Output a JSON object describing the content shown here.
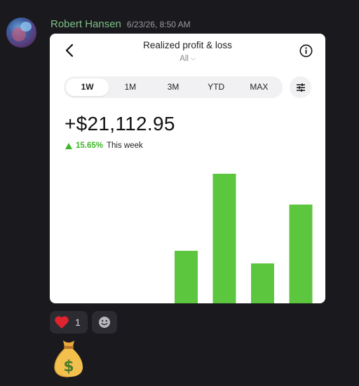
{
  "message": {
    "author": "Robert Hansen",
    "timestamp": "6/23/26, 8:50 AM"
  },
  "card": {
    "title": "Realized profit & loss",
    "filter": "All",
    "tabs": [
      "1W",
      "1M",
      "3M",
      "YTD",
      "MAX"
    ],
    "active_tab": "1W",
    "amount": "+$21,112.95",
    "change_pct": "15.65%",
    "change_period": "This week",
    "accent_color": "#5cc63f"
  },
  "chart_data": {
    "type": "bar",
    "title": "",
    "xlabel": "",
    "ylabel": "",
    "ylim": [
      0,
      185
    ],
    "series": [
      {
        "values": [
          0,
          0,
          0,
          75,
          185,
          57,
          141
        ]
      }
    ]
  },
  "reactions": [
    {
      "emoji": "heart",
      "count": "1"
    }
  ],
  "attachment_emoji": "money-bag"
}
